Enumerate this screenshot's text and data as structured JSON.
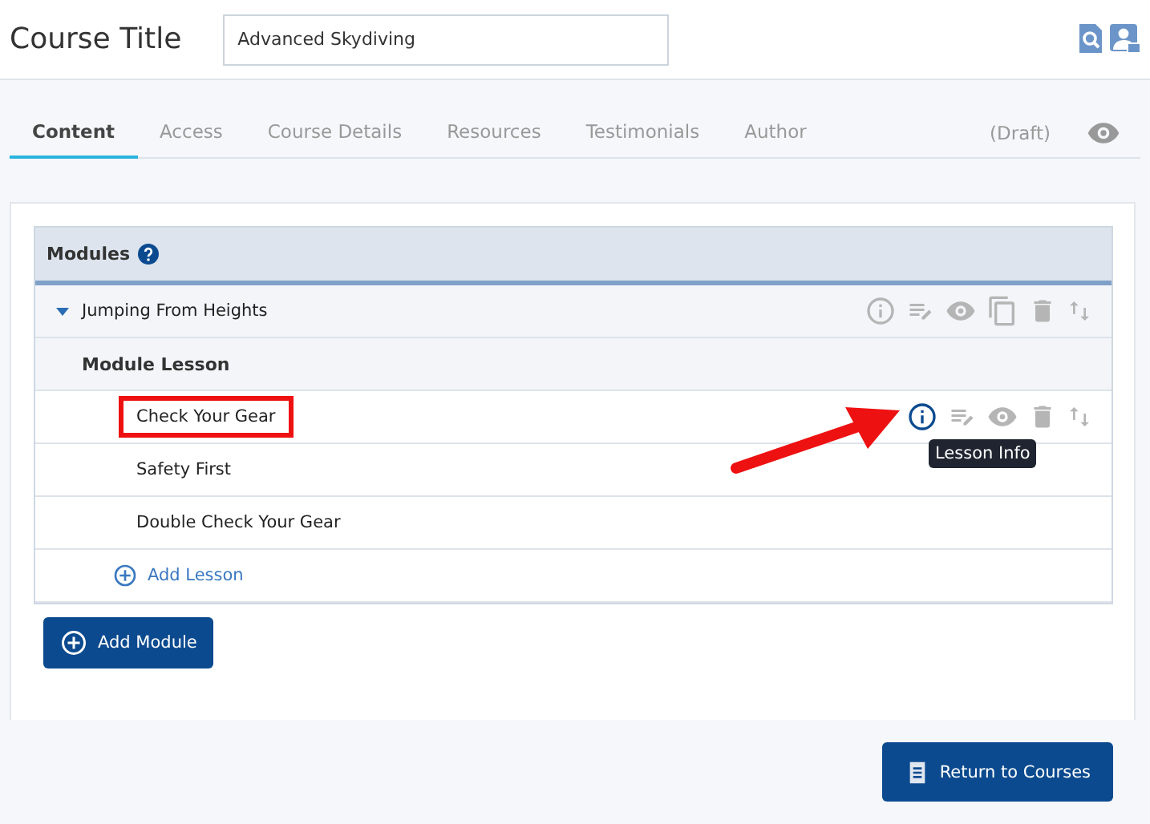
{
  "header": {
    "title": "Course Title",
    "course_name": "Advanced Skydiving"
  },
  "tabs": [
    {
      "label": "Content",
      "selected": true
    },
    {
      "label": "Access",
      "selected": false
    },
    {
      "label": "Course Details",
      "selected": false
    },
    {
      "label": "Resources",
      "selected": false
    },
    {
      "label": "Testimonials",
      "selected": false
    },
    {
      "label": "Author",
      "selected": false
    }
  ],
  "status": "(Draft)",
  "modules_panel": {
    "title": "Modules",
    "modules": [
      {
        "name": "Jumping From Heights",
        "expanded": true,
        "lesson_header": "Module Lesson",
        "lessons": [
          {
            "name": "Check Your Gear",
            "highlighted": true,
            "hovered": true,
            "tooltip": "Lesson Info"
          },
          {
            "name": "Safety First",
            "highlighted": false,
            "hovered": false
          },
          {
            "name": "Double Check Your Gear",
            "highlighted": false,
            "hovered": false
          }
        ],
        "add_lesson": "Add Lesson"
      }
    ],
    "add_module": "Add Module"
  },
  "return_button": "Return to Courses"
}
